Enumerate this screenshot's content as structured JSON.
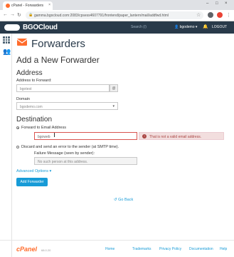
{
  "browser": {
    "tab_title": "cPanel - Forwarders",
    "url": "gamma.bgocloud.com:2083/cpsess4607791/frontend/paper_lantern/mail/addfwd.html",
    "tab_close": "×",
    "window_controls": [
      "–",
      "□",
      "×"
    ]
  },
  "header": {
    "logo_text": "BGOCloud",
    "search_placeholder": "Search (/)",
    "username": "bgodemo",
    "logout_label": "LOGOUT"
  },
  "page": {
    "title": "Forwarders",
    "section_heading": "Add a New Forwarder"
  },
  "address": {
    "heading": "Address",
    "address_label": "Address to Forward:",
    "address_value": "bgotest",
    "domain_label": "Domain",
    "domain_value": "bgodemo.com"
  },
  "destination": {
    "heading": "Destination",
    "forward_option_label": "Forward to Email Address",
    "forward_value": "bgoweb",
    "error_message": "That is not a valid email address.",
    "discard_option_label": "Discard and send an error to the sender (at SMTP time).",
    "failure_label": "Failure Message (seen by sender):",
    "failure_placeholder": "No such person at this address."
  },
  "actions": {
    "advanced_options_label": "Advanced Options",
    "add_forwarder_label": "Add Forwarder",
    "go_back_label": "Go Back"
  },
  "footer": {
    "logo_text": "cPanel",
    "version": "68.0.20",
    "links": [
      "Home",
      "Trademarks",
      "Privacy Policy",
      "Documentation",
      "Help"
    ]
  },
  "colors": {
    "header_bg": "#293a4a",
    "accent": "#179bd7",
    "cpanel_orange": "#ff6c2c",
    "error": "#a94442"
  }
}
